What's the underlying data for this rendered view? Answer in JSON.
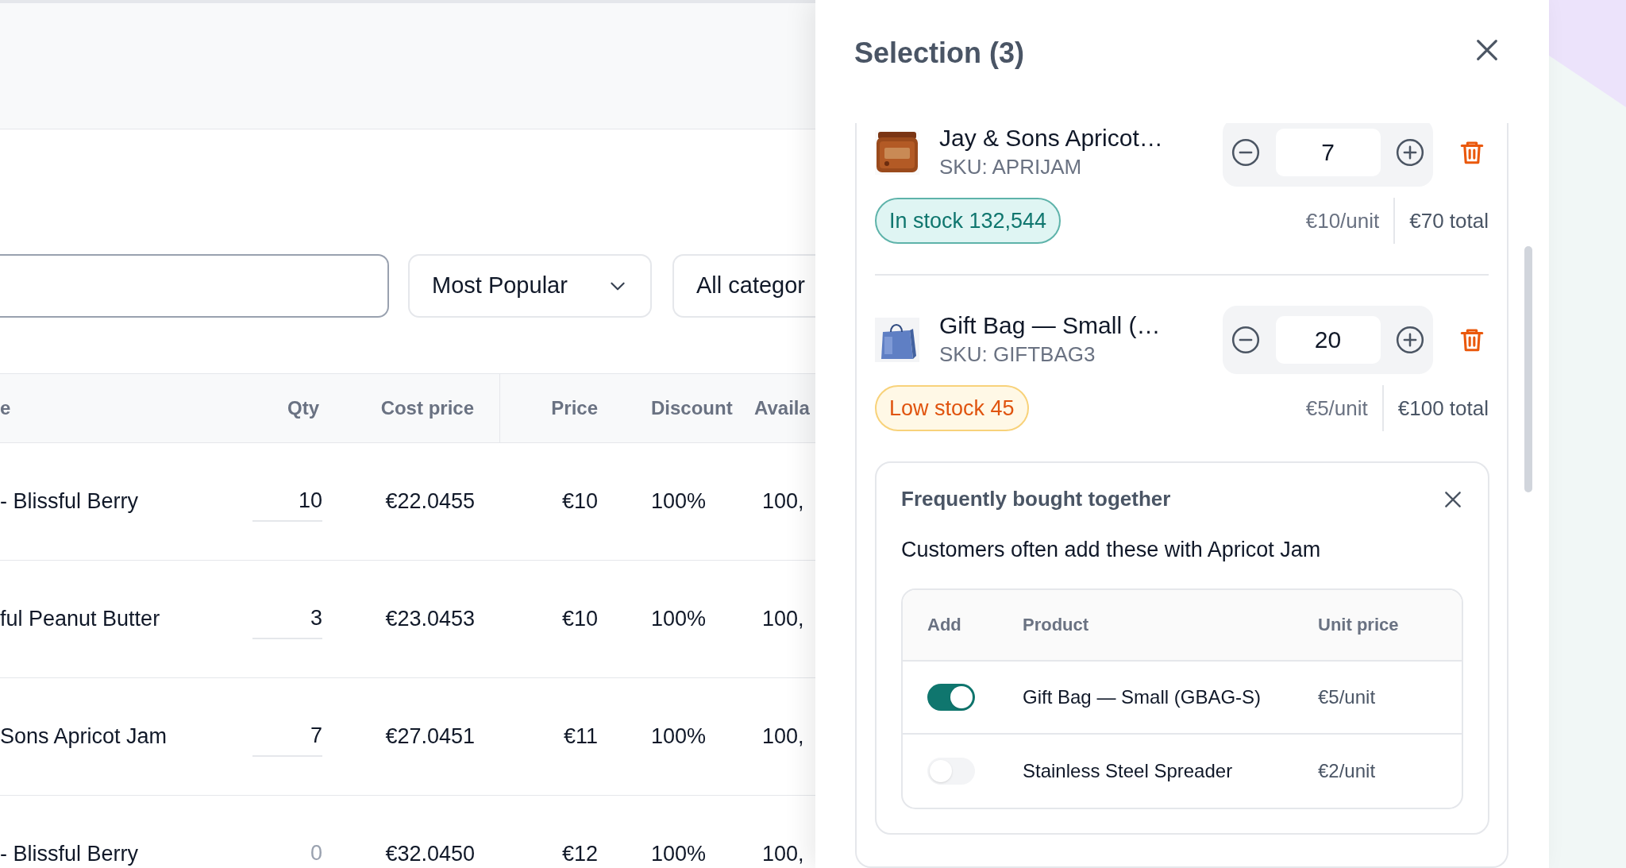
{
  "sort_dropdown": {
    "value": "Most Popular"
  },
  "category_dropdown": {
    "value": "All categor"
  },
  "table": {
    "columns": [
      "e",
      "Qty",
      "Cost price",
      "Price",
      "Discount",
      "Availa"
    ],
    "rows": [
      {
        "name": "- Blissful Berry",
        "qty": "10",
        "cost_price": "€22.0455",
        "price": "€10",
        "discount": "100%",
        "available": "100,"
      },
      {
        "name": "ful Peanut Butter",
        "qty": "3",
        "cost_price": "€23.0453",
        "price": "€10",
        "discount": "100%",
        "available": "100,"
      },
      {
        "name": "Sons Apricot Jam",
        "qty": "7",
        "cost_price": "€27.0451",
        "price": "€11",
        "discount": "100%",
        "available": "100,"
      },
      {
        "name": "- Blissful Berry",
        "qty_placeholder": "0",
        "cost_price": "€32.0450",
        "price": "€12",
        "discount": "100%",
        "available": "100,"
      }
    ]
  },
  "selection_panel": {
    "title": "Selection (3)",
    "items": [
      {
        "name": "Jay & Sons Apricot…",
        "sku": "SKU: APRIJAM",
        "quantity": "7",
        "stock": {
          "kind": "in_stock",
          "label": "In stock 132,544"
        },
        "unit_price": "€10/unit",
        "total": "€70 total"
      },
      {
        "name": "Gift Bag — Small (…",
        "sku": "SKU: GIFTBAG3",
        "quantity": "20",
        "stock": {
          "kind": "low_stock",
          "label": "Low stock 45"
        },
        "unit_price": "€5/unit",
        "total": "€100 total"
      }
    ],
    "frequently_bought": {
      "title": "Frequently bought together",
      "description": "Customers often add these with Apricot Jam",
      "columns": [
        "Add",
        "Product",
        "Unit price"
      ],
      "rows": [
        {
          "checked": true,
          "product": "Gift Bag — Small (GBAG-S)",
          "unit_price": "€5/unit"
        },
        {
          "checked": false,
          "product": "Stainless Steel Spreader",
          "unit_price": "€2/unit"
        }
      ]
    }
  }
}
